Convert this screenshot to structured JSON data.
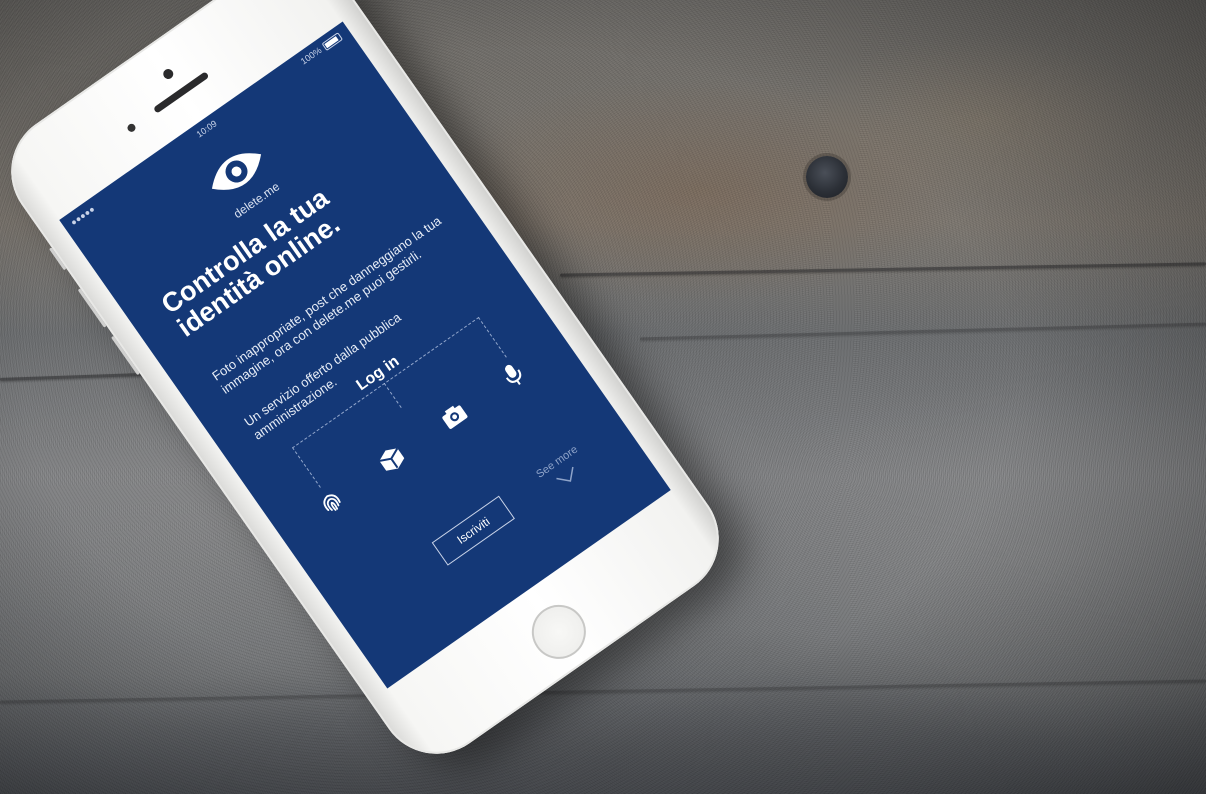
{
  "status": {
    "signal": "●●●●● ",
    "time": "10:09",
    "battery": "100%"
  },
  "app": {
    "brand": "delete.me",
    "headline": "Controlla la tua identità online.",
    "description": "Foto inappropriate, post che danneggiano la tua immagine, ora con delete.me puoi gestirli.",
    "service": "Un servizio offerto dalla pubblica amministrazione.",
    "login_label": "Log in",
    "signup_label": "Iscriviti",
    "see_more_label": "See more"
  },
  "icons": [
    "eye-logo-icon",
    "wifi-icon",
    "microphone-icon",
    "camera-icon",
    "box-icon",
    "fingerprint-icon",
    "chevron-down-icon"
  ],
  "colors": {
    "screen_background": "#143877",
    "phone_body": "#f4f4f2"
  }
}
